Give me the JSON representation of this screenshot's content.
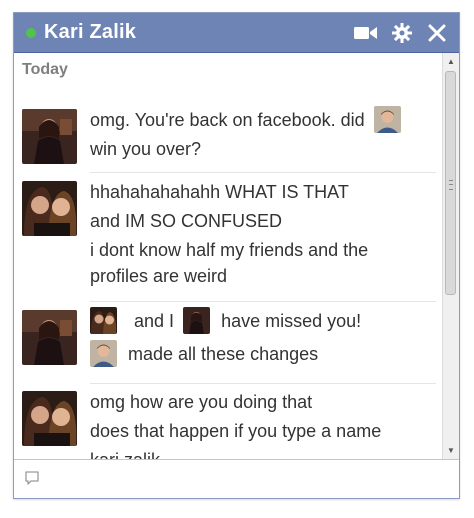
{
  "chat": {
    "contact_name": "Kari Zalik",
    "status": "online",
    "day_label": "Today",
    "composer_placeholder": ""
  },
  "icons": {
    "status": "online-dot",
    "video": "video-camera-icon",
    "settings": "gear-icon",
    "close": "close-icon",
    "composer": "chat-bubble-icon"
  },
  "colors": {
    "titlebar": "#6d84b4",
    "online": "#52c24b",
    "text": "#333333",
    "day_label": "#7f7f7f"
  },
  "messages": [
    {
      "sender": "Kari Zalik",
      "lines": [
        {
          "text": "omg. You're back on facebook. did",
          "trailing_avatar": "profile-picture"
        },
        {
          "text": "win you over?"
        }
      ]
    },
    {
      "sender": "me",
      "lines": [
        {
          "text": "hhahahahahahh WHAT IS THAT"
        },
        {
          "text": "and IM SO CONFUSED"
        },
        {
          "text": "i dont know half my friends and the"
        },
        {
          "text": "profiles are weird"
        }
      ]
    },
    {
      "sender": "Kari Zalik",
      "lines": [
        {
          "text_parts": [
            "and I",
            "have missed you!"
          ]
        },
        {
          "text": "made all these changes"
        }
      ]
    },
    {
      "sender": "me",
      "lines": [
        {
          "text": "omg how are you doing that"
        },
        {
          "text": "does that happen if you type a name"
        },
        {
          "text": "kari zalik"
        }
      ]
    }
  ]
}
